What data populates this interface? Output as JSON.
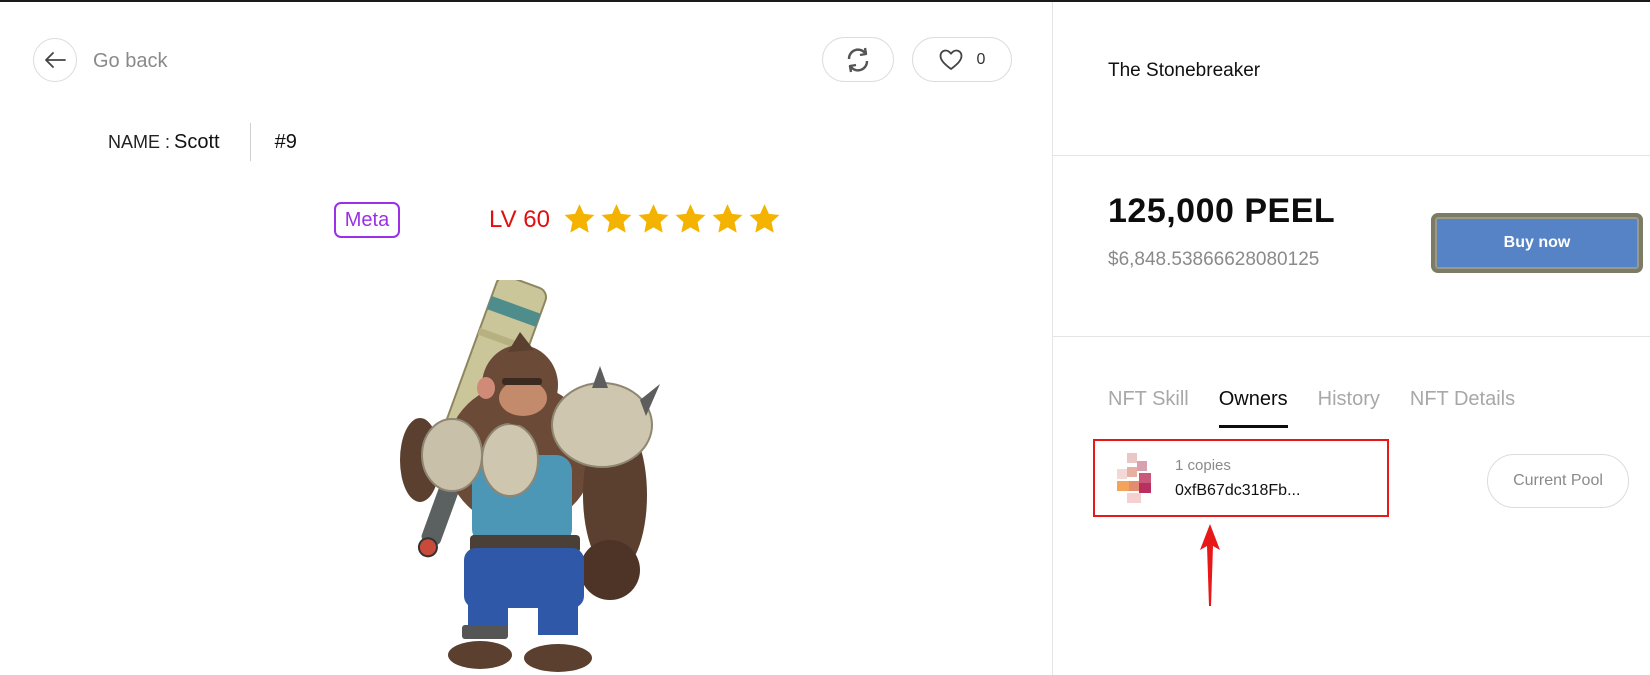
{
  "header": {
    "back_label": "Go back",
    "like_count": "0"
  },
  "nft": {
    "name_key": "NAME :",
    "name": "Scott",
    "id": "#9",
    "badge": "Meta",
    "level": "LV 60",
    "stars": 6
  },
  "detail": {
    "title": "The Stonebreaker",
    "price": "125,000 PEEL",
    "price_usd": "$6,848.53866628080125",
    "buy_label": "Buy now"
  },
  "tabs": [
    {
      "label": "NFT Skill",
      "active": false
    },
    {
      "label": "Owners",
      "active": true
    },
    {
      "label": "History",
      "active": false
    },
    {
      "label": "NFT Details",
      "active": false
    }
  ],
  "owner": {
    "copies": "1 copies",
    "address": "0xfB67dc318Fb..."
  },
  "pool_label": "Current Pool",
  "colors": {
    "badge": "#9b30e8",
    "level": "#e01010",
    "star": "#f5b301",
    "buy_button": "#5583c6",
    "highlight": "#e81818"
  }
}
